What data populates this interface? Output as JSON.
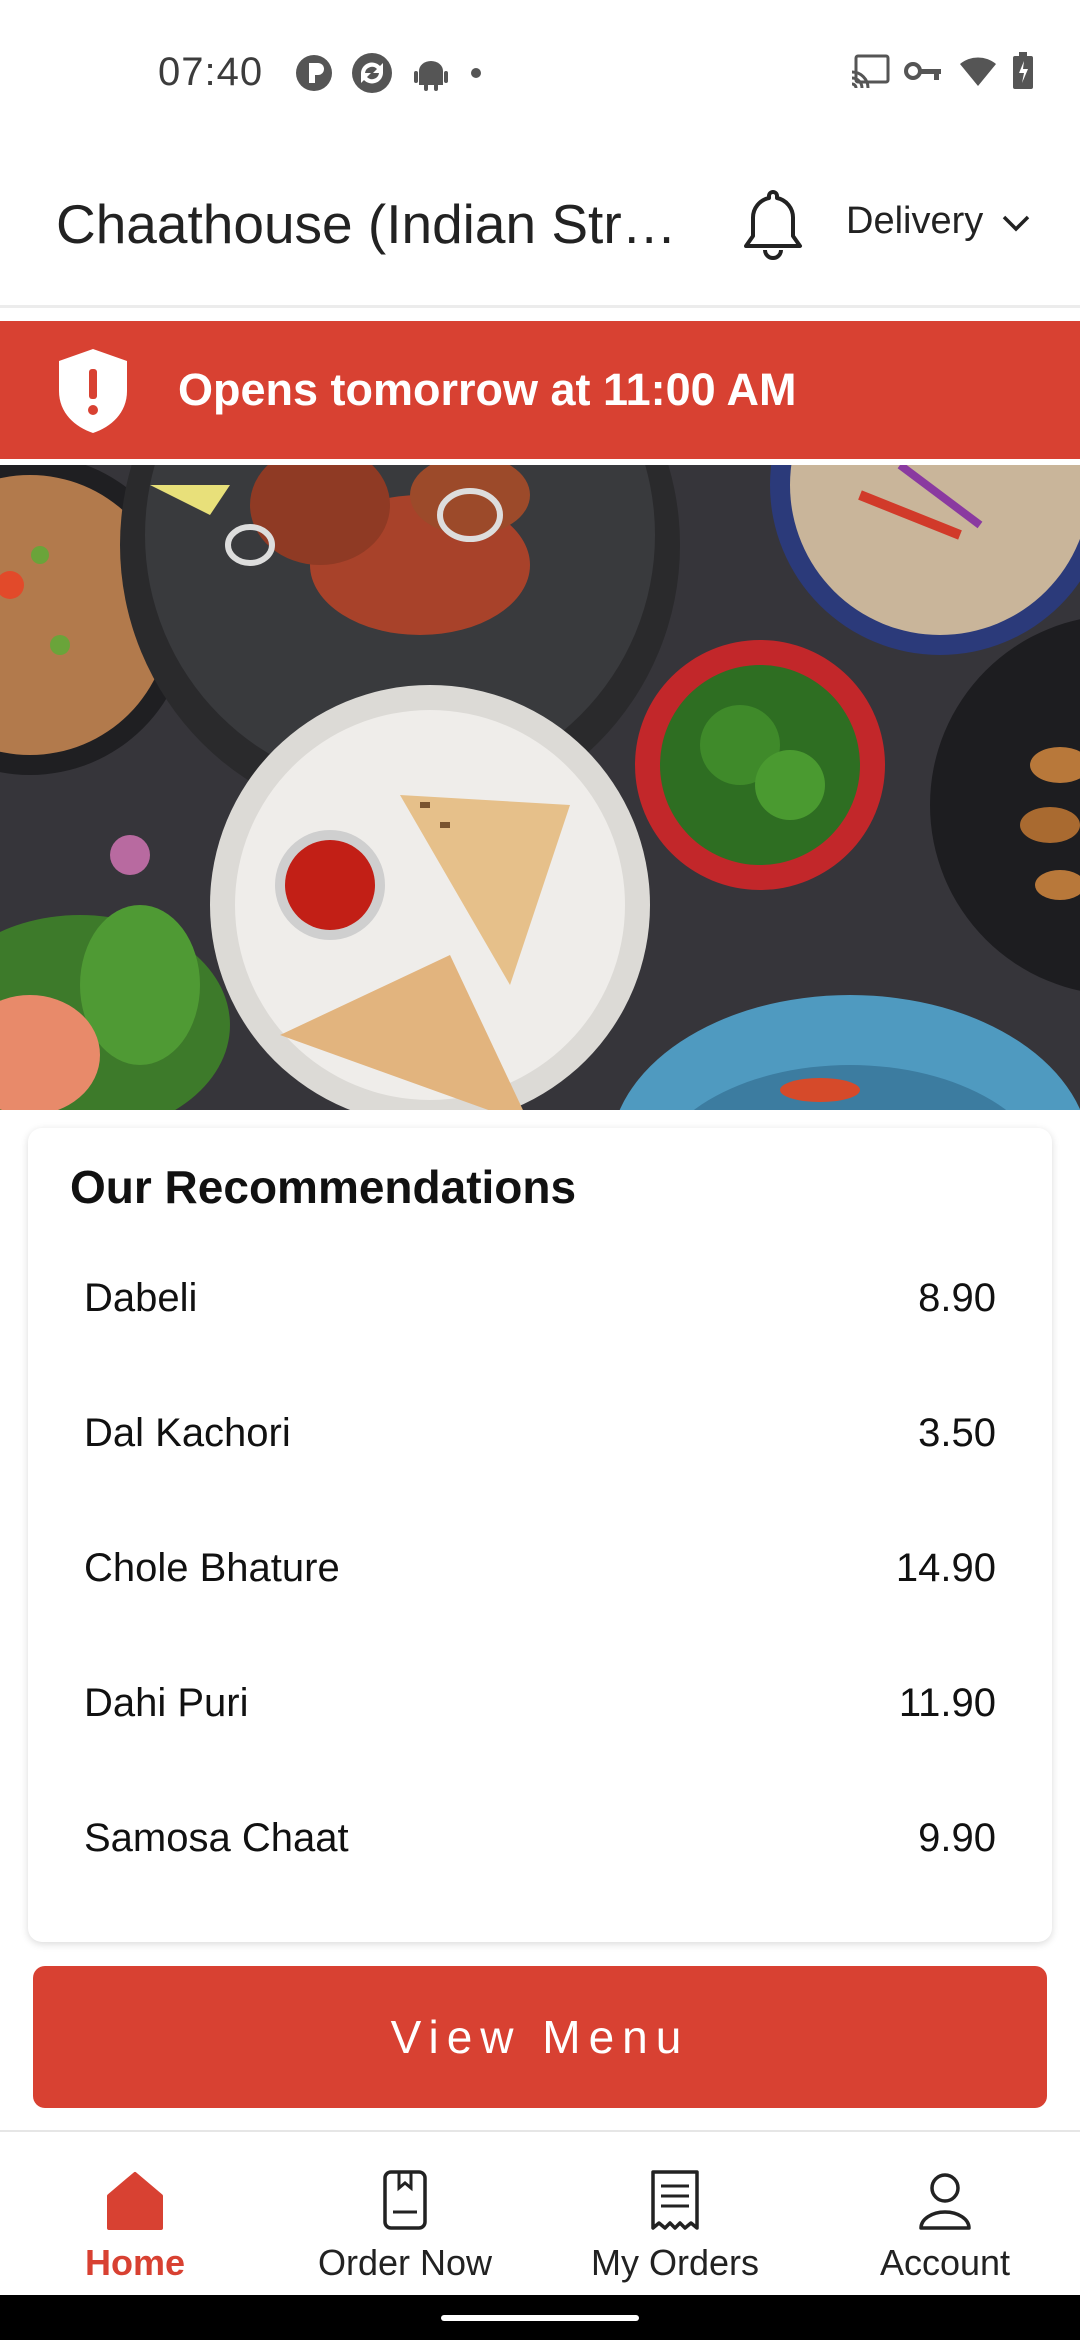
{
  "status_bar": {
    "time": "07:40",
    "left_icons": [
      "p-badge-icon",
      "sync-app-icon",
      "android-icon",
      "dot-icon"
    ],
    "right_icons": [
      "cast-icon",
      "vpn-key-icon",
      "wifi-icon",
      "battery-icon"
    ]
  },
  "header": {
    "title": "Chaathouse (Indian Street Food)",
    "mode_label": "Delivery"
  },
  "banner": {
    "text": "Opens tomorrow at 11:00 AM",
    "icon": "alert-shield-icon"
  },
  "recommendations": {
    "title": "Our Recommendations",
    "items": [
      {
        "name": "Dabeli",
        "price": "8.90"
      },
      {
        "name": "Dal Kachori",
        "price": "3.50"
      },
      {
        "name": "Chole Bhature",
        "price": "14.90"
      },
      {
        "name": "Dahi Puri",
        "price": "11.90"
      },
      {
        "name": "Samosa Chaat",
        "price": "9.90"
      }
    ]
  },
  "cta": {
    "label": "View Menu"
  },
  "bottom_nav": {
    "items": [
      {
        "label": "Home",
        "icon": "home-icon",
        "active": true
      },
      {
        "label": "Order Now",
        "icon": "order-book-icon",
        "active": false
      },
      {
        "label": "My Orders",
        "icon": "receipt-icon",
        "active": false
      },
      {
        "label": "Account",
        "icon": "person-icon",
        "active": false
      }
    ]
  },
  "colors": {
    "accent": "#d84132",
    "text": "#1a1a1a"
  }
}
